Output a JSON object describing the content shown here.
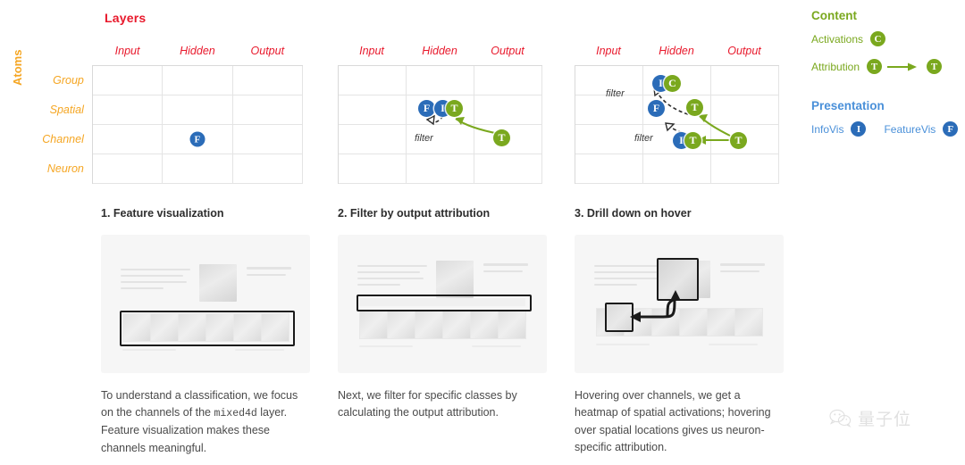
{
  "figure": {
    "axis_titles": {
      "columns": "Layers",
      "rows": "Atoms"
    },
    "column_headers": [
      "Input",
      "Hidden",
      "Output"
    ],
    "row_headers": [
      "Group",
      "Spatial",
      "Channel",
      "Neuron"
    ],
    "filter_label": "filter"
  },
  "matrices": [
    {
      "id": "matrix-1",
      "badges": [
        {
          "letter": "F",
          "color": "blue",
          "row": "Channel",
          "column": "Hidden"
        }
      ]
    },
    {
      "id": "matrix-2",
      "badges": [
        {
          "letter": "F",
          "color": "blue",
          "row": "Channel",
          "column": "Hidden"
        },
        {
          "letter": "I",
          "color": "blue",
          "row": "Channel",
          "column": "Hidden"
        },
        {
          "letter": "T",
          "color": "olive",
          "row": "Channel",
          "column": "Hidden"
        },
        {
          "letter": "T",
          "color": "olive",
          "row": "Neuron",
          "column": "Output"
        }
      ],
      "filter_labels": [
        "filter"
      ]
    },
    {
      "id": "matrix-3",
      "badges": [
        {
          "letter": "I",
          "color": "blue",
          "row": "Spatial",
          "column": "Hidden"
        },
        {
          "letter": "C",
          "color": "olive",
          "row": "Spatial",
          "column": "Hidden"
        },
        {
          "letter": "F",
          "color": "blue",
          "row": "Channel",
          "column": "Hidden"
        },
        {
          "letter": "T",
          "color": "olive",
          "row": "Channel",
          "column": "Output"
        },
        {
          "letter": "I",
          "color": "blue",
          "row": "Neuron",
          "column": "Hidden"
        },
        {
          "letter": "T",
          "color": "olive",
          "row": "Neuron",
          "column": "Hidden"
        },
        {
          "letter": "T",
          "color": "olive",
          "row": "Neuron",
          "column": "Output"
        }
      ],
      "filter_labels": [
        "filter",
        "filter"
      ]
    }
  ],
  "legend": {
    "content": {
      "title": "Content",
      "color": "#7aa81e",
      "items": [
        {
          "label": "Activations",
          "badges": [
            "C"
          ],
          "arrow": false
        },
        {
          "label": "Attribution",
          "badges": [
            "T",
            "T"
          ],
          "arrow": true
        }
      ]
    },
    "presentation": {
      "title": "Presentation",
      "color": "#4a90d9",
      "items": [
        {
          "label": "InfoVis",
          "badge": "I"
        },
        {
          "label": "FeatureVis",
          "badge": "F"
        }
      ]
    }
  },
  "panels": [
    {
      "heading": "1. Feature visualization",
      "caption_before": "To understand a classification, we focus on the channels of the ",
      "caption_code": "mixed4d",
      "caption_after": " layer. Feature visualization makes these channels meaningful."
    },
    {
      "heading": "2. Filter by output attribution",
      "caption": "Next, we filter for specific classes by calculating the output attribution."
    },
    {
      "heading": "3. Drill down on hover",
      "caption": "Hovering over channels, we get a heatmap of spatial activations; hovering over spatial locations gives us neuron-specific attribution."
    }
  ],
  "watermark": {
    "text": "量子位",
    "icon": "wechat-icon"
  },
  "colors": {
    "layers_red": "#e8192c",
    "atoms_orange": "#f5a623",
    "content_olive": "#7aa81e",
    "presentation_blue": "#4a90d9",
    "badge_blue": "#2b6cb8",
    "badge_olive": "#7aa81e"
  }
}
